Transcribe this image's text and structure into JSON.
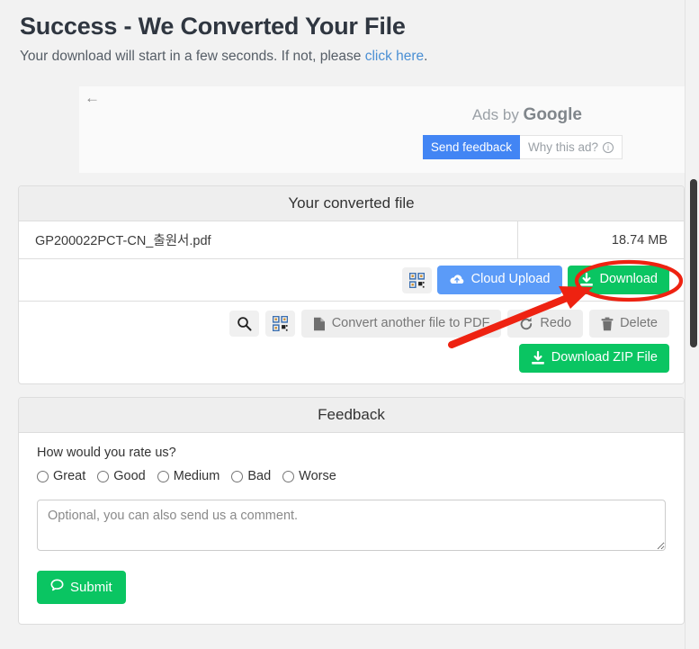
{
  "header": {
    "title": "Success - We Converted Your File",
    "subtitle_prefix": "Your download will start in a few seconds. If not, please ",
    "subtitle_link": "click here",
    "subtitle_suffix": "."
  },
  "ad": {
    "back_arrow": "←",
    "ads_by_prefix": "Ads by ",
    "ads_by_brand": "Google",
    "send_feedback_label": "Send feedback",
    "why_this_ad_label": "Why this ad?",
    "info_glyph": "i"
  },
  "converted_panel": {
    "heading": "Your converted file",
    "file_name": "GP200022PCT-CN_출원서.pdf",
    "file_size": "18.74 MB",
    "actions_primary": [
      {
        "name": "qr-code-button",
        "label": "",
        "icon": "qr-code-icon",
        "style": "icon"
      },
      {
        "name": "cloud-upload-button",
        "label": "Cloud Upload",
        "icon": "cloud-upload-icon",
        "style": "blue"
      },
      {
        "name": "download-button",
        "label": "Download",
        "icon": "download-icon",
        "style": "green"
      }
    ],
    "actions_secondary": [
      {
        "name": "search-button",
        "label": "",
        "icon": "search-icon",
        "style": "icon"
      },
      {
        "name": "qr-code-button-2",
        "label": "",
        "icon": "qr-code-icon",
        "style": "icon"
      },
      {
        "name": "convert-another-button",
        "label": "Convert another file to PDF",
        "icon": "file-icon",
        "style": "grey"
      },
      {
        "name": "redo-button",
        "label": "Redo",
        "icon": "redo-icon",
        "style": "grey"
      },
      {
        "name": "delete-button",
        "label": "Delete",
        "icon": "trash-icon",
        "style": "grey"
      }
    ],
    "download_zip_label": "Download ZIP File"
  },
  "feedback_panel": {
    "heading": "Feedback",
    "question": "How would you rate us?",
    "options": [
      "Great",
      "Good",
      "Medium",
      "Bad",
      "Worse"
    ],
    "comment_placeholder": "Optional, you can also send us a comment.",
    "submit_label": "Submit"
  },
  "annotation": {
    "highlight_target": "download-button",
    "color": "#ee2211",
    "shapes": [
      "ellipse",
      "arrow"
    ]
  },
  "colors": {
    "green": "#0ac562",
    "blue": "#5b9bf8",
    "ad_blue": "#4285f4",
    "page_bg": "#f2f2f2",
    "panel_header": "#eeeeee",
    "link": "#4a8fd4",
    "annotation_red": "#ee2211"
  }
}
